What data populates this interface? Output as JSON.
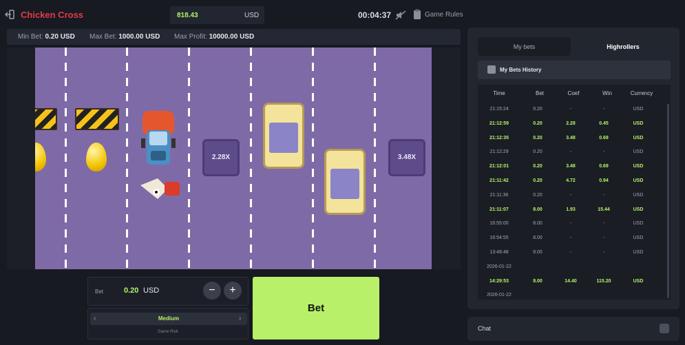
{
  "header": {
    "title": "Chicken Cross",
    "balance": "818.43",
    "currency": "USD",
    "clock": "00:04:37",
    "rules_label": "Game Rules"
  },
  "limits": {
    "min_bet_label": "Min Bet:",
    "min_bet_value": "0.20 USD",
    "max_bet_label": "Max Bet:",
    "max_bet_value": "1000.00 USD",
    "max_profit_label": "Max Profit:",
    "max_profit_value": "10000.00 USD"
  },
  "board": {
    "multipliers": [
      "2.28X",
      "3.48X"
    ]
  },
  "bet_panel": {
    "bet_label": "Bet",
    "bet_value": "0.20",
    "bet_currency": "USD",
    "minus": "−",
    "plus": "+",
    "risk_value": "Medium",
    "risk_caption": "Game Risk",
    "bet_button": "Bet"
  },
  "side": {
    "tabs": [
      "My bets",
      "Highrollers"
    ],
    "history_title": "My Bets History",
    "columns": [
      "Time",
      "Bet",
      "Coef",
      "Win",
      "Currency"
    ],
    "rows": [
      {
        "time": "21:15:24",
        "bet": "0.20",
        "coef": "-",
        "win": "-",
        "cur": "USD",
        "state": "lose"
      },
      {
        "time": "21:12:59",
        "bet": "0.20",
        "coef": "2.28",
        "win": "0.45",
        "cur": "USD",
        "state": "win"
      },
      {
        "time": "21:12:35",
        "bet": "0.20",
        "coef": "3.48",
        "win": "0.69",
        "cur": "USD",
        "state": "win"
      },
      {
        "time": "21:12:29",
        "bet": "0.20",
        "coef": "-",
        "win": "-",
        "cur": "USD",
        "state": "lose"
      },
      {
        "time": "21:12:01",
        "bet": "0.20",
        "coef": "3.48",
        "win": "0.69",
        "cur": "USD",
        "state": "win"
      },
      {
        "time": "21:11:42",
        "bet": "0.20",
        "coef": "4.72",
        "win": "0.94",
        "cur": "USD",
        "state": "win"
      },
      {
        "time": "21:11:36",
        "bet": "0.20",
        "coef": "-",
        "win": "-",
        "cur": "USD",
        "state": "lose"
      },
      {
        "time": "21:11:07",
        "bet": "8.00",
        "coef": "1.93",
        "win": "15.44",
        "cur": "USD",
        "state": "win"
      },
      {
        "time": "16:55:00",
        "bet": "8.00",
        "coef": "-",
        "win": "-",
        "cur": "USD",
        "state": "lose"
      },
      {
        "time": "16:54:55",
        "bet": "8.00",
        "coef": "-",
        "win": "-",
        "cur": "USD",
        "state": "lose"
      },
      {
        "time": "13:48:48",
        "bet": "8.00",
        "coef": "-",
        "win": "-",
        "cur": "USD",
        "state": "lose"
      },
      {
        "time": "2026-01-22",
        "state": "date"
      },
      {
        "time": "14:29:53",
        "bet": "8.00",
        "coef": "14.40",
        "win": "115.20",
        "cur": "USD",
        "state": "win"
      },
      {
        "time": "2026-01-22",
        "state": "date"
      }
    ],
    "chat_label": "Chat"
  }
}
